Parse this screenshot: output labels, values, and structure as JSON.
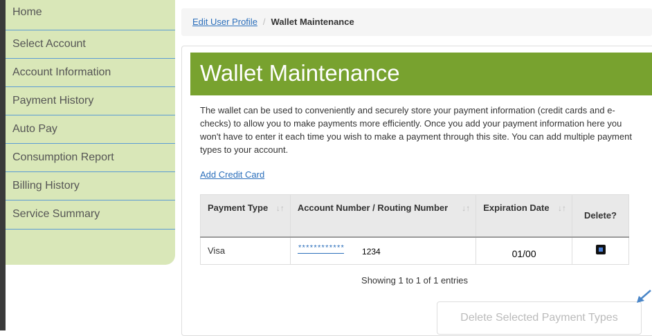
{
  "sidebar": {
    "items": [
      {
        "label": "Home"
      },
      {
        "label": "Select Account"
      },
      {
        "label": "Account Information"
      },
      {
        "label": "Payment History"
      },
      {
        "label": "Auto Pay"
      },
      {
        "label": "Consumption Report"
      },
      {
        "label": "Billing History"
      },
      {
        "label": "Service Summary"
      }
    ]
  },
  "breadcrumb": {
    "link": "Edit User Profile",
    "separator": "/",
    "current": "Wallet Maintenance"
  },
  "main": {
    "title": "Wallet Maintenance",
    "description": "The wallet can be used to conveniently and securely store your payment information (credit cards and e-checks) to allow you to make payments more efficiently. Once you add your payment information here you won't have to enter it each time you wish to make a payment through this site. You can add multiple payment types to your account.",
    "add_card_label": "Add Credit Card",
    "table": {
      "headers": {
        "payment_type": "Payment Type",
        "account_number": "Account Number / Routing Number",
        "expiration": "Expiration Date",
        "delete": "Delete?"
      },
      "rows": [
        {
          "payment_type": "Visa",
          "masked": "************",
          "last4": "1234",
          "expiration": "01/00",
          "delete_checked": true
        }
      ]
    },
    "showing_text": "Showing 1 to 1 of 1 entries",
    "delete_button_label": "Delete Selected Payment Types"
  },
  "colors": {
    "sidebar_bg": "#d9e7b8",
    "banner_bg": "#78a22f",
    "link": "#2a6ebb",
    "accent_arrow": "#4a86c8"
  },
  "icons": {
    "sort": "sort-icon",
    "checkbox": "checkbox-icon",
    "pointer_arrow": "arrow-icon"
  }
}
